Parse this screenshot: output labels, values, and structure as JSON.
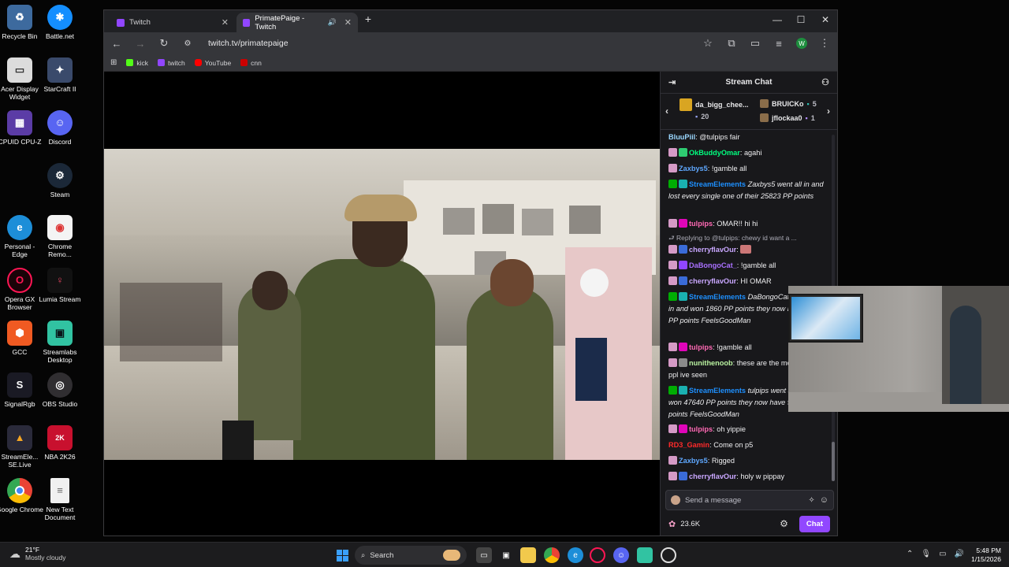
{
  "desktop_icons": [
    {
      "label": "Recycle Bin",
      "icon": "recycle-bin-icon",
      "color": "#4a7fb8"
    },
    {
      "label": "Battle.net",
      "icon": "battlenet-icon",
      "color": "#148eff"
    },
    {
      "label": "Acer Display Widget",
      "icon": "acer-display-icon",
      "color": "#d9d9d9"
    },
    {
      "label": "StarCraft II",
      "icon": "starcraft-icon",
      "color": "#3a4a6b"
    },
    {
      "label": "CPUID CPU-Z",
      "icon": "cpuz-icon",
      "color": "#5b3ca6"
    },
    {
      "label": "Discord",
      "icon": "discord-icon",
      "color": "#5865f2"
    },
    {
      "label": "Steam",
      "icon": "steam-icon",
      "color": "#1b2838"
    },
    {
      "label": "Personal - Edge",
      "icon": "edge-icon",
      "color": "#1d8ed8"
    },
    {
      "label": "Chrome Remo...",
      "icon": "chrome-remote-icon",
      "color": "#ffffff"
    },
    {
      "label": "Opera GX Browser",
      "icon": "opera-gx-icon",
      "color": "#ff1654"
    },
    {
      "label": "Lumia Stream",
      "icon": "lumia-icon",
      "color": "#e0445f"
    },
    {
      "label": "GCC",
      "icon": "gcc-icon",
      "color": "#f05a22"
    },
    {
      "label": "Streamlabs Desktop",
      "icon": "streamlabs-icon",
      "color": "#31c3a2"
    },
    {
      "label": "SignalRgb",
      "icon": "signalrgb-icon",
      "color": "#1a1a24"
    },
    {
      "label": "OBS Studio",
      "icon": "obs-icon",
      "color": "#302e31"
    },
    {
      "label": "StreamEle... SE.Live",
      "icon": "streamelements-icon",
      "color": "#2a2a3a"
    },
    {
      "label": "NBA 2K26",
      "icon": "nba2k-icon",
      "color": "#c8102e"
    },
    {
      "label": "Google Chrome",
      "icon": "chrome-icon",
      "color": "#ea4335"
    },
    {
      "label": "New Text Document",
      "icon": "text-document-icon",
      "color": "#f0f0f0"
    }
  ],
  "browser": {
    "tabs": [
      {
        "title": "Twitch"
      },
      {
        "title": "PrimatePaige - Twitch"
      }
    ],
    "new_tab": "+",
    "url": "twitch.tv/primatepaige",
    "profile_initial": "W",
    "bookmarks": [
      {
        "label": "kick",
        "color": "#53fc18"
      },
      {
        "label": "twitch",
        "color": "#9146ff"
      },
      {
        "label": "YouTube",
        "color": "#ff0000"
      },
      {
        "label": "cnn",
        "color": "#cc0000"
      }
    ]
  },
  "chat": {
    "title": "Stream Chat",
    "leaderboard": {
      "top_gifter": "da_bigg_chee...",
      "top_gifter_count": "20",
      "second": "BRUICKo",
      "second_count": "5",
      "third": "jflockaa0",
      "third_count": "1"
    },
    "messages": [
      {
        "user": "BluuPiil",
        "color": "#9ad7ff",
        "text": ": @tulpips fair"
      },
      {
        "user": "OkBuddyOmar",
        "color": "#00ff7f",
        "text": ": agahi"
      },
      {
        "user": "Zaxbys5",
        "color": "#5fa8ff",
        "text": ": !gamble all"
      },
      {
        "user": "StreamElements",
        "color": "#1e90ff",
        "text": "Zaxbys5 went all in and lost every single one of their 25823 PP points"
      },
      {
        "user": "tulpips",
        "color": "#ff69b4",
        "text": ": OMAR!! hi hi"
      },
      {
        "reply": "Replying to @tulpips: chewy id want a ..."
      },
      {
        "user": "cherryflavOur",
        "color": "#c9a7ff",
        "text": ":"
      },
      {
        "user": "DaBongoCat_",
        "color": "#a970ff",
        "text": ": !gamble all"
      },
      {
        "user": "cherryflavOur",
        "color": "#c9a7ff",
        "text": ": HI OMAR"
      },
      {
        "user": "StreamElements",
        "color": "#1e90ff",
        "text": "DaBongoCat_ went all in and won 1860 PP points they now have 3720 PP points FeelsGoodMan"
      },
      {
        "user": "tulpips",
        "color": "#ff69b4",
        "text": ": !gamble all"
      },
      {
        "user": "nunithenoob",
        "color": "#b9f2a0",
        "text": ": these are the most floridian ppl ive seen"
      },
      {
        "user": "StreamElements",
        "color": "#1e90ff",
        "text": "tulpips went all in and won 47640 PP points they now have 95280 PP points FeelsGoodMan"
      },
      {
        "user": "tulpips",
        "color": "#ff69b4",
        "text": ": oh yippie"
      },
      {
        "user": "RD3_Gamin",
        "color": "#ff2a2a",
        "text": ": Come on p5"
      },
      {
        "user": "Zaxbys5",
        "color": "#5fa8ff",
        "text": ": Rigged"
      },
      {
        "user": "cherryflavOur",
        "color": "#c9a7ff",
        "text": ": holy w pippay"
      }
    ],
    "input_placeholder": "Send a message",
    "points": "23.6K",
    "chat_button": "Chat"
  },
  "taskbar": {
    "weather_temp": "21°F",
    "weather_desc": "Mostly cloudy",
    "search_placeholder": "Search",
    "time": "5:48 PM",
    "date": "1/15/2026"
  }
}
